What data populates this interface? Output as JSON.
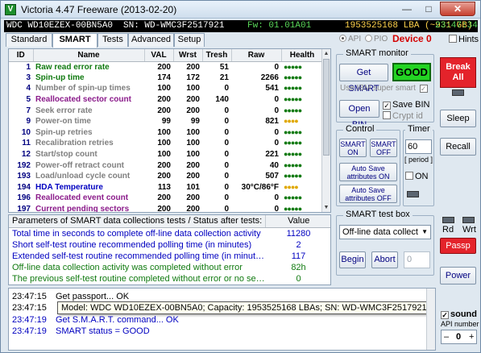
{
  "window": {
    "title": "Victoria 4.47 Freeware (2013-02-20)",
    "app_icon": "V",
    "minimize_glyph": "—",
    "maximize_glyph": "□",
    "close_glyph": "✕"
  },
  "infobar": {
    "model": "WDC WD10EZEX-00BN5A0",
    "serial": "SN: WD-WMC3F2517921",
    "fw": "Fw: 01.01A01",
    "lba": "1953525168 LBA (~931 GB)",
    "time": "23:47:34"
  },
  "tabs": [
    {
      "label": "Standard",
      "active": false
    },
    {
      "label": "SMART",
      "active": true
    },
    {
      "label": "Tests",
      "active": false
    },
    {
      "label": "Advanced",
      "active": false
    },
    {
      "label": "Setup",
      "active": false
    }
  ],
  "mode": {
    "api_label": "API",
    "pio_label": "PIO",
    "selected": "API"
  },
  "device_label": "Device 0",
  "hints_label": "Hints",
  "smart_table": {
    "headers": [
      "ID",
      "Name",
      "VAL",
      "Wrst",
      "Tresh",
      "Raw",
      "Health"
    ],
    "rows": [
      {
        "id": "1",
        "name": "Raw read error rate",
        "val": "200",
        "wrst": "200",
        "tresh": "51",
        "raw": "0",
        "health": "●●●●●",
        "color": "#107a10",
        "health_color": "#107a10"
      },
      {
        "id": "3",
        "name": "Spin-up time",
        "val": "174",
        "wrst": "172",
        "tresh": "21",
        "raw": "2266",
        "health": "●●●●●",
        "color": "#107a10",
        "health_color": "#107a10"
      },
      {
        "id": "4",
        "name": "Number of spin-up times",
        "val": "100",
        "wrst": "100",
        "tresh": "0",
        "raw": "541",
        "health": "●●●●●",
        "color": "#7f7f7f",
        "health_color": "#107a10"
      },
      {
        "id": "5",
        "name": "Reallocated sector count",
        "val": "200",
        "wrst": "200",
        "tresh": "140",
        "raw": "0",
        "health": "●●●●●",
        "color": "#8a1a8a",
        "health_color": "#107a10"
      },
      {
        "id": "7",
        "name": "Seek error rate",
        "val": "200",
        "wrst": "200",
        "tresh": "0",
        "raw": "0",
        "health": "●●●●●",
        "color": "#7f7f7f",
        "health_color": "#107a10"
      },
      {
        "id": "9",
        "name": "Power-on time",
        "val": "99",
        "wrst": "99",
        "tresh": "0",
        "raw": "821",
        "health": "●●●●",
        "color": "#7f7f7f",
        "health_color": "#e0a800"
      },
      {
        "id": "10",
        "name": "Spin-up retries",
        "val": "100",
        "wrst": "100",
        "tresh": "0",
        "raw": "0",
        "health": "●●●●●",
        "color": "#7f7f7f",
        "health_color": "#107a10"
      },
      {
        "id": "11",
        "name": "Recalibration retries",
        "val": "100",
        "wrst": "100",
        "tresh": "0",
        "raw": "0",
        "health": "●●●●●",
        "color": "#7f7f7f",
        "health_color": "#107a10"
      },
      {
        "id": "12",
        "name": "Start/stop count",
        "val": "100",
        "wrst": "100",
        "tresh": "0",
        "raw": "221",
        "health": "●●●●●",
        "color": "#7f7f7f",
        "health_color": "#107a10"
      },
      {
        "id": "192",
        "name": "Power-off retract count",
        "val": "200",
        "wrst": "200",
        "tresh": "0",
        "raw": "40",
        "health": "●●●●●",
        "color": "#7f7f7f",
        "health_color": "#107a10"
      },
      {
        "id": "193",
        "name": "Load/unload cycle count",
        "val": "200",
        "wrst": "200",
        "tresh": "0",
        "raw": "507",
        "health": "●●●●●",
        "color": "#7f7f7f",
        "health_color": "#107a10"
      },
      {
        "id": "194",
        "name": "HDA Temperature",
        "val": "113",
        "wrst": "101",
        "tresh": "0",
        "raw": "30°C/86°F",
        "health": "●●●●",
        "color": "#0000c0",
        "health_color": "#e0a800"
      },
      {
        "id": "196",
        "name": "Reallocated event count",
        "val": "200",
        "wrst": "200",
        "tresh": "0",
        "raw": "0",
        "health": "●●●●●",
        "color": "#8a1a8a",
        "health_color": "#107a10"
      },
      {
        "id": "197",
        "name": "Current pending sectors",
        "val": "200",
        "wrst": "200",
        "tresh": "0",
        "raw": "0",
        "health": "●●●●●",
        "color": "#8a1a8a",
        "health_color": "#107a10"
      }
    ]
  },
  "params": {
    "header": "Parameters of SMART data collections tests / Status after tests:",
    "value_header": "Value",
    "rows": [
      {
        "label": "Total time in seconds to complete off-line data collection activity",
        "value": "11280",
        "color": "#0000c0"
      },
      {
        "label": "Short self-test routine recommended polling time (in minutes)",
        "value": "2",
        "color": "#0000c0"
      },
      {
        "label": "Extended self-test routine recommended polling time (in minutes)",
        "value": "117",
        "color": "#0000c0"
      },
      {
        "label": "Off-line data collection activity was completed without error",
        "value": "82h",
        "color": "#107a10"
      },
      {
        "label": "The previous self-test routine completed without error or no self-t...",
        "value": "0",
        "color": "#107a10"
      }
    ]
  },
  "smart_monitor": {
    "title": "SMART monitor",
    "get_smart": "Get SMART",
    "status": "GOOD",
    "ibm_label": "Use IBM super smart",
    "open_bin": "Open BIN",
    "save_bin": "Save BIN",
    "crypt_id": "Crypt id"
  },
  "control": {
    "title": "Control",
    "smart_on": "SMART ON",
    "smart_off": "SMART OFF",
    "autosave_on": "Auto Save attributes ON",
    "autosave_off": "Auto Save attributes OFF"
  },
  "timer": {
    "title": "Timer",
    "value": "60",
    "period_label": "[ period ]",
    "on_label": "ON"
  },
  "test_box": {
    "title": "SMART test box",
    "selected": "Off-line data collect",
    "begin": "Begin",
    "abort": "Abort",
    "number": "0"
  },
  "right_panel": {
    "break_all": "Break All",
    "sleep": "Sleep",
    "recall": "Recall",
    "rd": "Rd",
    "wrt": "Wrt",
    "passp": "Passp",
    "power": "Power",
    "sound": "sound",
    "api_number_label": "API number",
    "api_number": "0",
    "minus": "–",
    "plus": "+"
  },
  "log": [
    {
      "time": "23:47:15",
      "text": "Get passport... OK",
      "color": "#000000"
    },
    {
      "time": "23:47:15",
      "text": "Model: WDC WD10EZEX-00BN5A0; Capacity: 1953525168 LBAs; SN: WD-WMC3F2517921; FW: 01.01A01",
      "color": "#000000"
    },
    {
      "time": "23:47:19",
      "text": "Get S.M.A.R.T. command... OK",
      "color": "#0000c0"
    },
    {
      "time": "23:47:19",
      "text": "SMART status = GOOD",
      "color": "#0000c0"
    }
  ],
  "colors": {
    "accent_green": "#23d423",
    "break_red": "#e4232b",
    "device_red": "#d40000"
  },
  "icons": {
    "arrow_up": "▲",
    "arrow_down": "▼",
    "dropdown": "▼",
    "check": "✓"
  }
}
